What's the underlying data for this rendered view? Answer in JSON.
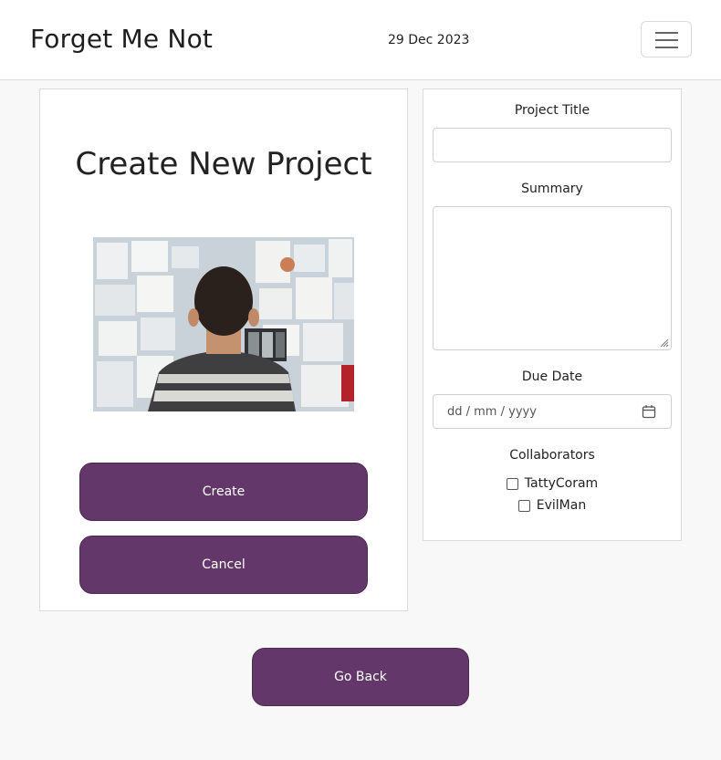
{
  "navbar": {
    "brand": "Forget Me Not",
    "date": "29 Dec 2023",
    "menu_icon": "hamburger-menu-icon"
  },
  "create_card": {
    "title": "Create New Project",
    "image_description_icon": "project-board-photo",
    "create_label": "Create",
    "cancel_label": "Cancel"
  },
  "form": {
    "title_label": "Project Title",
    "title_value": "",
    "summary_label": "Summary",
    "summary_value": "",
    "due_date_label": "Due Date",
    "due_date_placeholder": "dd / mm / yyyy",
    "calendar_icon": "calendar-icon",
    "collaborators_label": "Collaborators",
    "collaborators": [
      {
        "name": "TattyCoram",
        "checked": false
      },
      {
        "name": "EvilMan",
        "checked": false
      }
    ]
  },
  "footer": {
    "back_label": "Go Back"
  },
  "colors": {
    "accent": "#633769",
    "background": "#f8f8f8",
    "card": "#ffffff"
  }
}
